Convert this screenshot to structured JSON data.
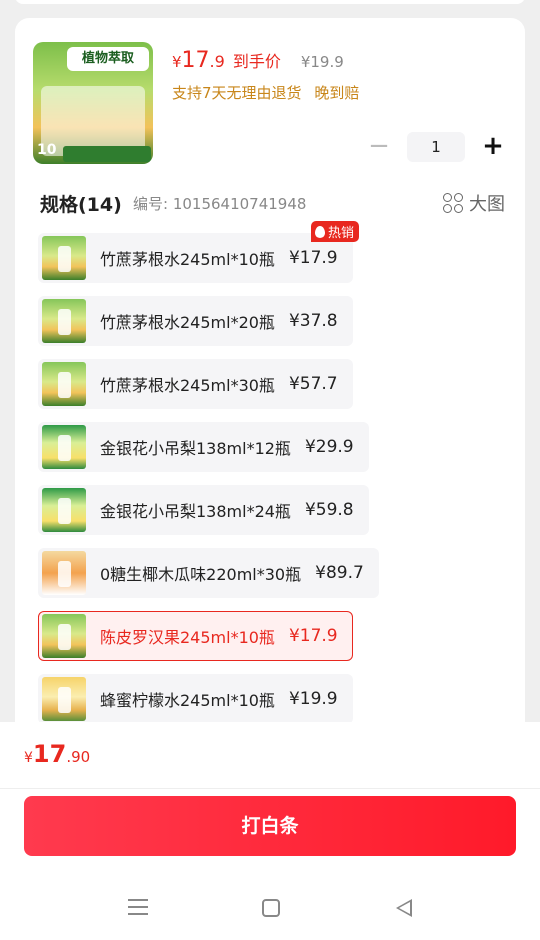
{
  "product": {
    "thumb_badge": "植物萃取",
    "thumb_ten": "10",
    "price_currency": "¥",
    "price_int": "17",
    "price_dec": ".9",
    "price_tag": "到手价",
    "orig_price": "¥19.9",
    "promise_return": "支持7天无理由退货",
    "promise_late": "晚到赔",
    "quantity": "1"
  },
  "spec": {
    "title": "规格(14)",
    "code": "编号: 10156410741948",
    "big_image": "大图",
    "hot_label": "热销",
    "options": [
      {
        "label": "竹蔗茅根水245ml*10瓶",
        "price": "¥17.9"
      },
      {
        "label": "竹蔗茅根水245ml*20瓶",
        "price": "¥37.8"
      },
      {
        "label": "竹蔗茅根水245ml*30瓶",
        "price": "¥57.7"
      },
      {
        "label": "金银花小吊梨138ml*12瓶",
        "price": "¥29.9"
      },
      {
        "label": "金银花小吊梨138ml*24瓶",
        "price": "¥59.8"
      },
      {
        "label": "0糖生椰木瓜味220ml*30瓶",
        "price": "¥89.7"
      },
      {
        "label": "陈皮罗汉果245ml*10瓶",
        "price": "¥17.9"
      },
      {
        "label": "蜂蜜柠檬水245ml*10瓶",
        "price": "¥19.9"
      }
    ]
  },
  "footer": {
    "total_currency": "¥",
    "total_int": "17",
    "total_dec": ".90",
    "cta_label": "打白条"
  },
  "colors": {
    "accent": "#e8281f",
    "promise": "#c8861a",
    "cta_start": "#ff3a4e",
    "cta_end": "#ff1a2a"
  },
  "icons": [
    "plus-icon",
    "minus-icon",
    "grid-icon",
    "flame-icon",
    "menu-icon",
    "home-icon",
    "back-icon"
  ]
}
